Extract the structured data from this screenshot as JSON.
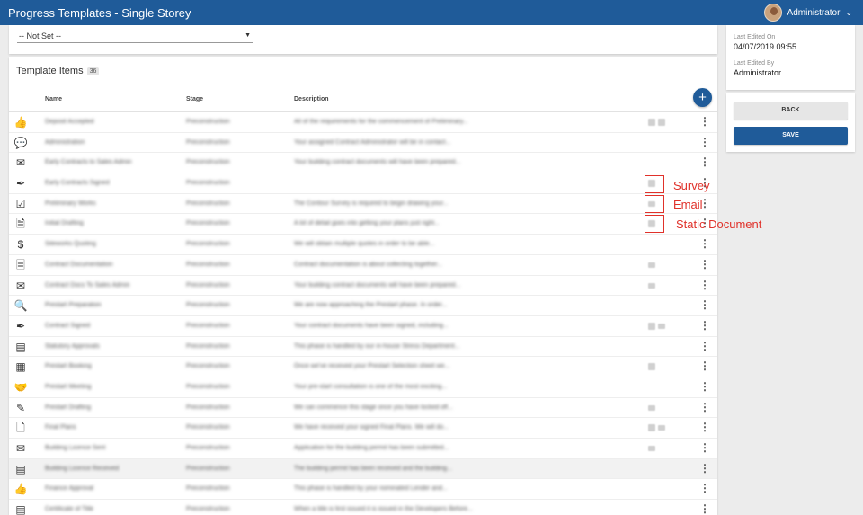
{
  "header": {
    "title": "Progress Templates - Single Storey",
    "user_name": "Administrator"
  },
  "filter": {
    "selected": "-- Not Set --"
  },
  "template_items": {
    "title": "Template Items",
    "count": "36",
    "columns": {
      "name": "Name",
      "stage": "Stage",
      "description": "Description"
    },
    "rows": [
      {
        "icon": "thumbs-up-icon",
        "glyph": "👍",
        "name": "Deposit Accepted",
        "stage": "Preconstruction",
        "description": "All of the requirements for the commencement of Preliminary...",
        "tags": [
          "doc",
          "doc"
        ]
      },
      {
        "icon": "chat-bubbles-icon",
        "glyph": "💬",
        "name": "Administration",
        "stage": "Preconstruction",
        "description": "Your assigned Contract Administrator will be in contact...",
        "tags": []
      },
      {
        "icon": "mail-icon",
        "glyph": "✉",
        "name": "Early Contracts to Sales Admin",
        "stage": "Preconstruction",
        "description": "Your building contract documents will have been prepared...",
        "tags": []
      },
      {
        "icon": "pen-icon",
        "glyph": "✒",
        "name": "Early Contracts Signed",
        "stage": "Preconstruction",
        "description": "",
        "tags": [
          "doc"
        ]
      },
      {
        "icon": "clipboard-check-icon",
        "glyph": "☑",
        "name": "Preliminary Works",
        "stage": "Preconstruction",
        "description": "The Contour Survey is required to begin drawing your...",
        "tags": [
          "env"
        ]
      },
      {
        "icon": "document-icon",
        "glyph": "🗎",
        "name": "Initial Drafting",
        "stage": "Preconstruction",
        "description": "A lot of detail goes into getting your plans just right...",
        "tags": [
          "doc"
        ]
      },
      {
        "icon": "dollar-icon",
        "glyph": "$",
        "name": "Siteworks Quoting",
        "stage": "Preconstruction",
        "description": "We will obtain multiple quotes in order to be able...",
        "tags": []
      },
      {
        "icon": "file-text-icon",
        "glyph": "🗏",
        "name": "Contract Documentation",
        "stage": "Preconstruction",
        "description": "Contract documentation is about collecting together...",
        "tags": [
          "env"
        ]
      },
      {
        "icon": "mail-icon",
        "glyph": "✉",
        "name": "Contract Docs To Sales Admin",
        "stage": "Preconstruction",
        "description": "Your building contract documents will have been prepared...",
        "tags": [
          "env"
        ]
      },
      {
        "icon": "magnifier-icon",
        "glyph": "🔍",
        "name": "Prestart Preparation",
        "stage": "Preconstruction",
        "description": "We are now approaching the Prestart phase. In order...",
        "tags": []
      },
      {
        "icon": "pen-icon",
        "glyph": "✒",
        "name": "Contract Signed",
        "stage": "Preconstruction",
        "description": "Your contract documents have been signed, including...",
        "tags": [
          "doc",
          "env"
        ]
      },
      {
        "icon": "checklist-icon",
        "glyph": "▤",
        "name": "Statutory Approvals",
        "stage": "Preconstruction",
        "description": "This phase is handled by our in-house Stress Department...",
        "tags": []
      },
      {
        "icon": "calendar-icon",
        "glyph": "▦",
        "name": "Prestart Booking",
        "stage": "Preconstruction",
        "description": "Once we've received your Prestart Selection sheet we...",
        "tags": [
          "doc"
        ]
      },
      {
        "icon": "handshake-icon",
        "glyph": "🤝",
        "name": "Prestart Meeting",
        "stage": "Preconstruction",
        "description": "Your pre-start consultation is one of the most exciting...",
        "tags": []
      },
      {
        "icon": "drafting-icon",
        "glyph": "✎",
        "name": "Prestart Drafting",
        "stage": "Preconstruction",
        "description": "We can commence this stage once you have locked off...",
        "tags": [
          "env"
        ]
      },
      {
        "icon": "file-edit-icon",
        "glyph": "🗋",
        "name": "Final Plans",
        "stage": "Preconstruction",
        "description": "We have received your signed Final Plans. We will do...",
        "tags": [
          "doc",
          "env"
        ]
      },
      {
        "icon": "mail-icon",
        "glyph": "✉",
        "name": "Building Licence Sent",
        "stage": "Preconstruction",
        "description": "Application for the building permit has been submitted...",
        "tags": [
          "env"
        ]
      },
      {
        "icon": "checklist-icon",
        "glyph": "▤",
        "name": "Building Licence Received",
        "stage": "Preconstruction",
        "description": "The building permit has been received and the building...",
        "tags": [],
        "highlight": true
      },
      {
        "icon": "thumbs-up-icon",
        "glyph": "👍",
        "name": "Finance Approval",
        "stage": "Preconstruction",
        "description": "This phase is handled by your nominated Lender and...",
        "tags": []
      },
      {
        "icon": "checklist-icon",
        "glyph": "▤",
        "name": "Certificate of Title",
        "stage": "Preconstruction",
        "description": "When a title is first issued it is issued in the Developers Before...",
        "tags": []
      }
    ]
  },
  "annotations": {
    "survey": "Survey",
    "email": "Email",
    "static_document": "Static Document"
  },
  "meta": {
    "last_edited_on_label": "Last Edited On",
    "last_edited_on": "04/07/2019 09:55",
    "last_edited_by_label": "Last Edited By",
    "last_edited_by": "Administrator"
  },
  "actions": {
    "back": "BACK",
    "save": "SAVE"
  },
  "colors": {
    "brand": "#1f5b99",
    "annotation": "#e0312a"
  }
}
